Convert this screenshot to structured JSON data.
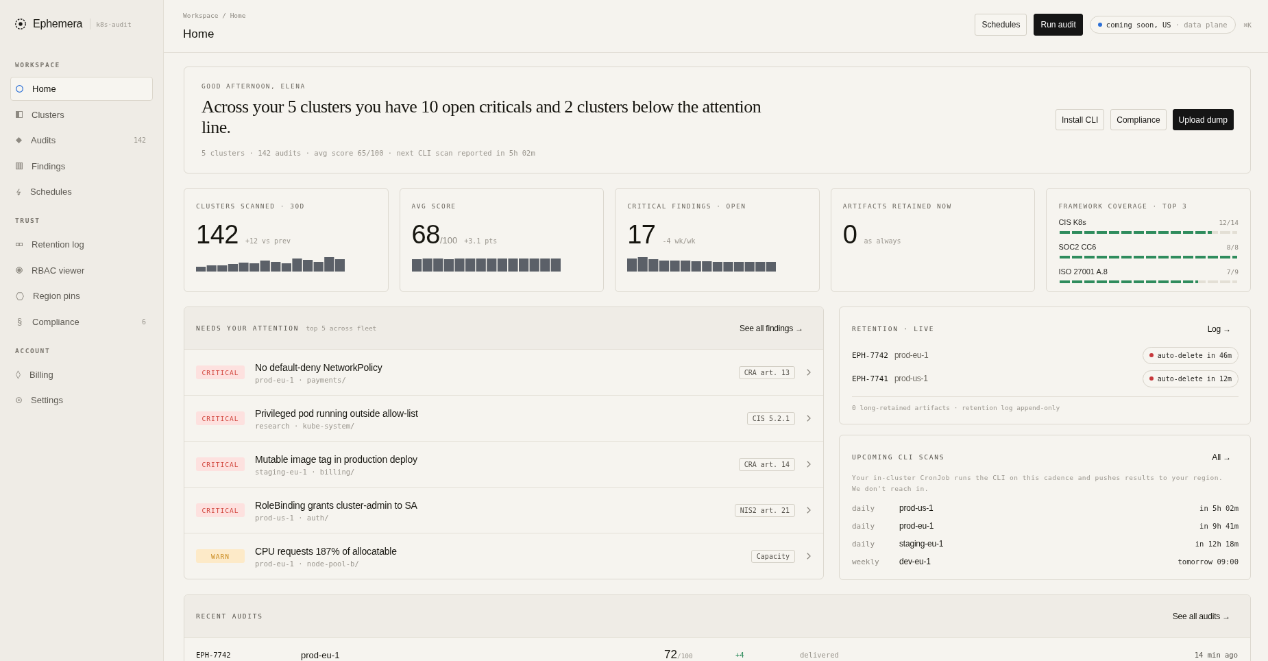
{
  "sidebar": {
    "brand": {
      "name": "Ephemera",
      "tag": "k8s·audit"
    },
    "sections": [
      {
        "title": "WORKSPACE",
        "items": [
          {
            "label": "Home",
            "selected": true
          },
          {
            "label": "Clusters",
            "selected": false
          },
          {
            "label": "Audits",
            "count": "142",
            "selected": false
          },
          {
            "label": "Findings",
            "selected": false
          },
          {
            "label": "Schedules",
            "selected": false
          }
        ]
      },
      {
        "title": "TRUST",
        "items": [
          {
            "label": "Retention log",
            "selected": false
          },
          {
            "label": "RBAC viewer",
            "selected": false
          },
          {
            "label": "Region pins",
            "selected": false
          },
          {
            "label": "Compliance",
            "glyph": "§",
            "count": "6",
            "selected": false
          }
        ]
      },
      {
        "title": "ACCOUNT",
        "items": [
          {
            "label": "Billing",
            "selected": false
          },
          {
            "label": "Settings",
            "selected": false
          }
        ]
      }
    ]
  },
  "header": {
    "breadcrumb": "Workspace / Home",
    "title": "Home",
    "buttons": [
      {
        "label": "Schedules",
        "primary": false
      },
      {
        "label": "Run audit",
        "primary": true
      }
    ],
    "region": {
      "name": "coming soon, US",
      "plane": "· data plane"
    },
    "shortcut": "⌘K"
  },
  "hero": {
    "greeting": "GOOD AFTERNOON, ELENA",
    "headline": "Across your 5 clusters you have 10 open criticals and 2 clusters below the attention line.",
    "summary": "5 clusters · 142 audits · avg score 65/100 · next CLI scan reported in 5h 02m",
    "buttons": [
      {
        "label": "Install CLI",
        "primary": false
      },
      {
        "label": "Compliance",
        "primary": false
      },
      {
        "label": "Upload dump",
        "primary": true
      }
    ]
  },
  "stats": [
    {
      "kind": "spark",
      "label": "CLUSTERS SCANNED · 30D",
      "value": "142",
      "delta": "+12 vs prev"
    },
    {
      "kind": "spark",
      "label": "AVG SCORE",
      "value": "68",
      "unit": "/100",
      "delta": "+3.1 pts"
    },
    {
      "kind": "spark",
      "label": "CRITICAL FINDINGS · OPEN",
      "value": "17",
      "delta": "-4 wk/wk"
    },
    {
      "kind": "plain",
      "label": "ARTIFACTS RETAINED NOW",
      "value": "0",
      "delta": "as always"
    },
    {
      "kind": "coverage",
      "label": "FRAMEWORK COVERAGE · TOP 3",
      "items": [
        {
          "name": "CIS K8s",
          "count": "12/14",
          "level": 0.857
        },
        {
          "name": "SOC2 CC6",
          "count": "8/8",
          "level": 1
        },
        {
          "name": "ISO 27001 A.8",
          "count": "7/9",
          "level": 0.778
        }
      ]
    }
  ],
  "attention": {
    "title": "NEEDS YOUR ATTENTION",
    "subtitle": "top 5 across fleet",
    "link": "See all findings →",
    "rows": [
      {
        "kind": "critical",
        "badge": "CRITICAL",
        "title": "No default-deny NetworkPolicy",
        "location": "prod-eu-1 · payments/",
        "tag": "CRA art. 13"
      },
      {
        "kind": "critical",
        "badge": "CRITICAL",
        "title": "Privileged pod running outside allow-list",
        "location": "research · kube-system/",
        "tag": "CIS 5.2.1"
      },
      {
        "kind": "critical",
        "badge": "CRITICAL",
        "title": "Mutable image tag in production deploy",
        "location": "staging-eu-1 · billing/",
        "tag": "CRA art. 14"
      },
      {
        "kind": "critical",
        "badge": "CRITICAL",
        "title": "RoleBinding grants cluster-admin to SA",
        "location": "prod-us-1 · auth/",
        "tag": "NIS2 art. 21"
      },
      {
        "kind": "warn",
        "badge": "WARN",
        "title": "CPU requests 187% of allocatable",
        "location": "prod-eu-1 · node-pool-b/",
        "tag": "Capacity"
      }
    ]
  },
  "retention": {
    "title": "RETENTION · LIVE",
    "link": "Log →",
    "rows": [
      {
        "id": "EPH-7742",
        "cluster": "prod-eu-1",
        "status": "auto-delete in 46m"
      },
      {
        "id": "EPH-7741",
        "cluster": "prod-us-1",
        "status": "auto-delete in 12m"
      }
    ],
    "footnote": "0 long-retained artifacts · retention log append-only"
  },
  "upcoming": {
    "title": "UPCOMING CLI SCANS",
    "link": "All →",
    "description": "Your in-cluster CronJob runs the CLI on this cadence and pushes results to your region. We don't reach in.",
    "rows": [
      {
        "cadence": "daily",
        "cluster": "prod-us-1",
        "when": "in 5h 02m"
      },
      {
        "cadence": "daily",
        "cluster": "prod-eu-1",
        "when": "in 9h 41m"
      },
      {
        "cadence": "daily",
        "cluster": "staging-eu-1",
        "when": "in 12h 18m"
      },
      {
        "cadence": "weekly",
        "cluster": "dev-eu-1",
        "when": "tomorrow 09:00"
      }
    ]
  },
  "recent_audits": {
    "title": "RECENT AUDITS",
    "link": "See all audits →",
    "rows": [
      {
        "id": "EPH-7742",
        "cluster": "prod-eu-1",
        "score": "72",
        "score_max": "/100",
        "delta": "+4",
        "status": "delivered",
        "age": "14 min ago"
      }
    ]
  }
}
